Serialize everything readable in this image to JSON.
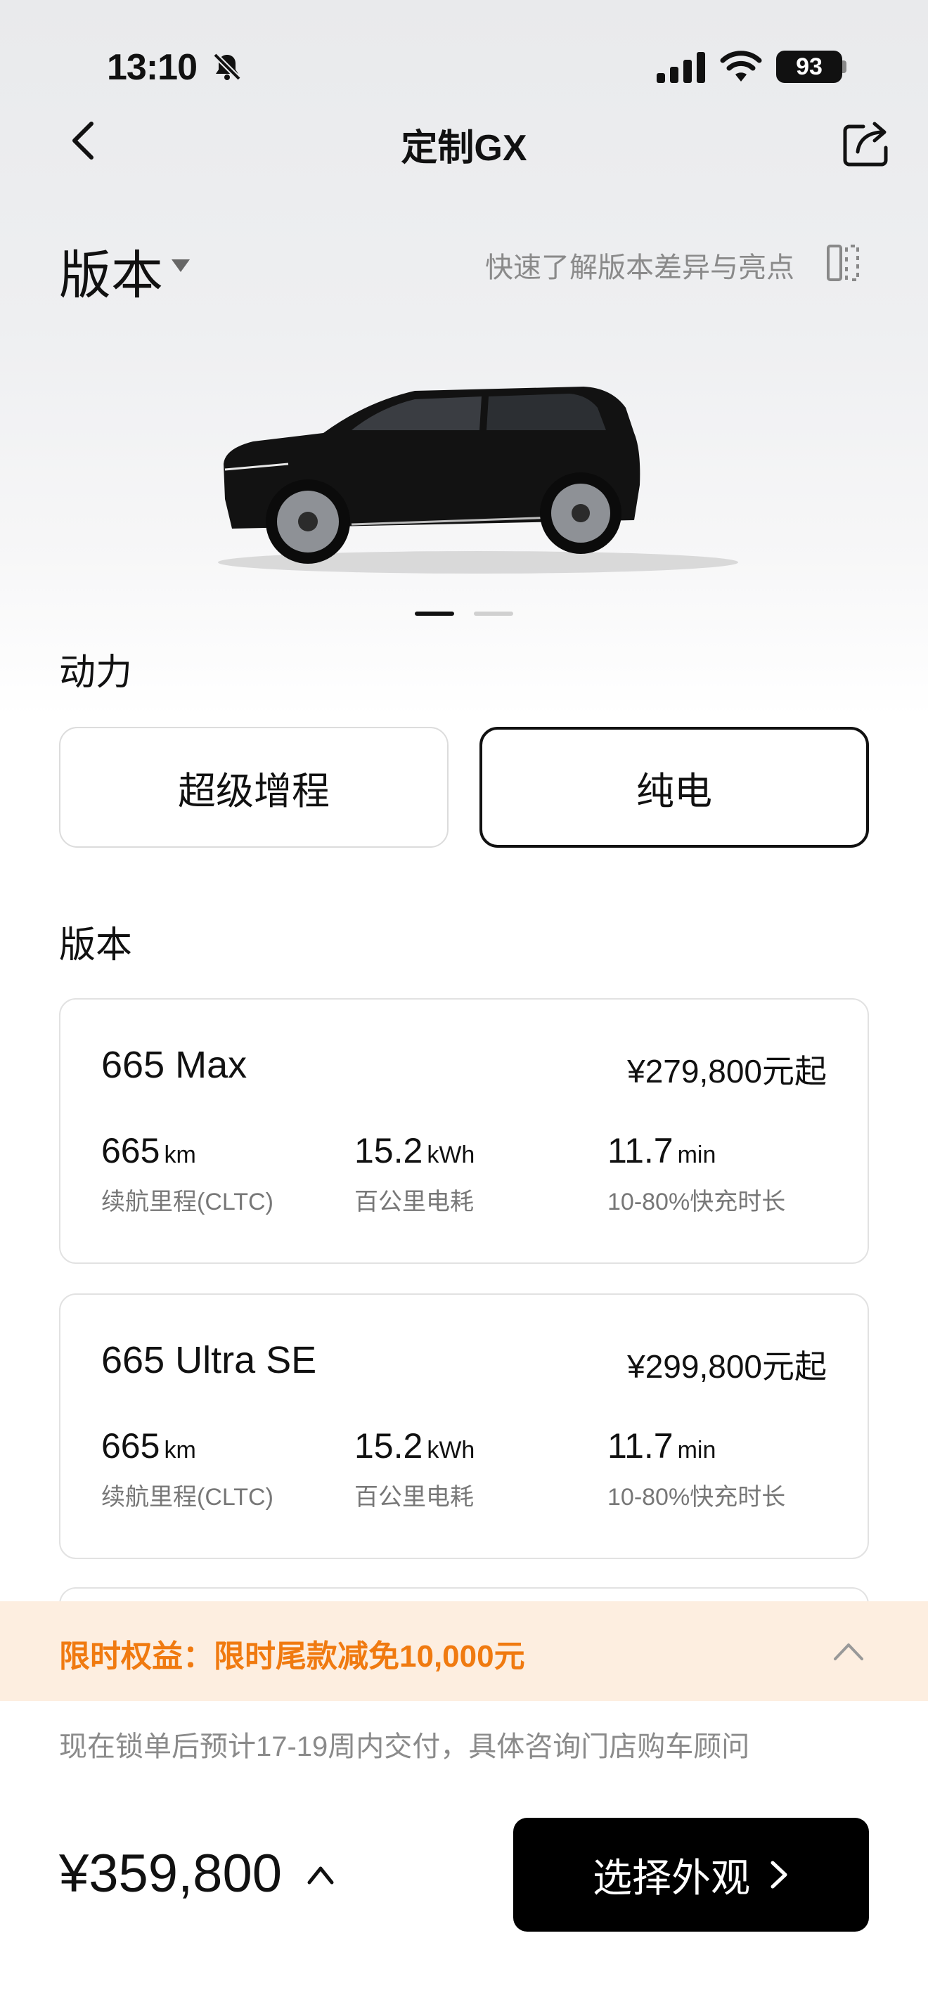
{
  "status": {
    "time": "13:10",
    "battery": "93"
  },
  "nav": {
    "title": "定制GX"
  },
  "version_header": {
    "title": "版本",
    "diff_link": "快速了解版本差异与亮点"
  },
  "carousel": {
    "pages": 2,
    "active": 1
  },
  "power": {
    "label": "动力",
    "options": [
      "超级增程",
      "纯电"
    ],
    "selected": "纯电"
  },
  "versions": {
    "label": "版本",
    "items": [
      {
        "name": "665 Max",
        "price": "¥279,800元起",
        "specs": [
          {
            "value": "665",
            "unit": "km",
            "label": "续航里程(CLTC)"
          },
          {
            "value": "15.2",
            "unit": "kWh",
            "label": "百公里电耗"
          },
          {
            "value": "11.7",
            "unit": "min",
            "label": "10-80%快充时长"
          }
        ]
      },
      {
        "name": "665 Ultra SE",
        "price": "¥299,800元起",
        "specs": [
          {
            "value": "665",
            "unit": "km",
            "label": "续航里程(CLTC)"
          },
          {
            "value": "15.2",
            "unit": "kWh",
            "label": "百公里电耗"
          },
          {
            "value": "11.7",
            "unit": "min",
            "label": "10-80%快充时长"
          }
        ]
      }
    ]
  },
  "promo": {
    "text": "限时权益：限时尾款减免10,000元",
    "color": "#f07a10"
  },
  "delivery_note": "现在锁单后预计17-19周内交付，具体咨询门店购车顾问",
  "bottom": {
    "total": "¥359,800",
    "cta": "选择外观"
  }
}
